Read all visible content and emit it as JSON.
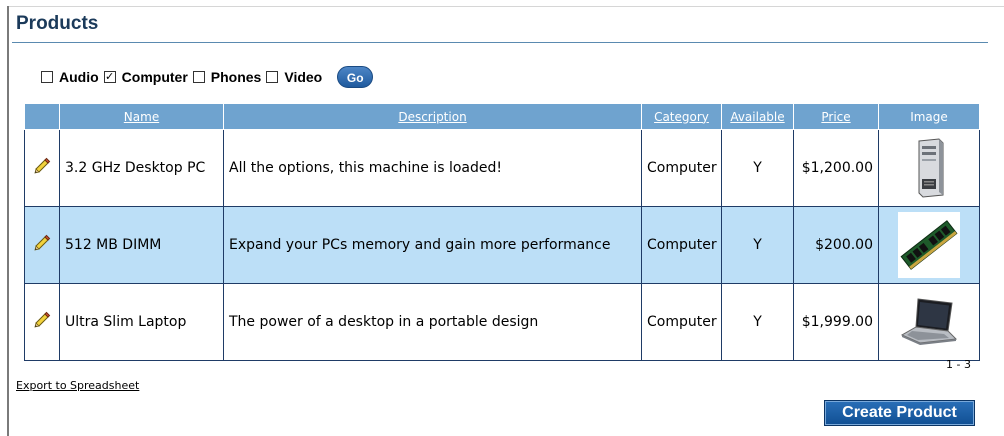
{
  "page": {
    "title": "Products"
  },
  "filters": {
    "items": [
      {
        "label": "Audio",
        "checked": false
      },
      {
        "label": "Computer",
        "checked": true
      },
      {
        "label": "Phones",
        "checked": false
      },
      {
        "label": "Video",
        "checked": false
      }
    ],
    "go_label": "Go"
  },
  "table": {
    "headers": {
      "name": "Name",
      "description": "Description",
      "category": "Category",
      "available": "Available",
      "price": "Price",
      "image": "Image"
    },
    "rows": [
      {
        "name": "3.2 GHz Desktop PC",
        "description": "All the options, this machine is loaded!",
        "category": "Computer",
        "available": "Y",
        "price": "$1,200.00",
        "image_icon": "desktop-tower-icon"
      },
      {
        "name": "512 MB DIMM",
        "description": "Expand your PCs memory and gain more performance",
        "category": "Computer",
        "available": "Y",
        "price": "$200.00",
        "image_icon": "memory-module-icon"
      },
      {
        "name": "Ultra Slim Laptop",
        "description": "The power of a desktop in a portable design",
        "category": "Computer",
        "available": "Y",
        "price": "$1,999.00",
        "image_icon": "laptop-icon"
      }
    ]
  },
  "pager": {
    "range": "1 - 3"
  },
  "export_label": "Export to Spreadsheet",
  "create_label": "Create Product",
  "colors": {
    "header_bg": "#6fa3cf",
    "row_highlight": "#bcdff7",
    "button_blue": "#1f5a9e",
    "title_text": "#1b3a5a"
  }
}
